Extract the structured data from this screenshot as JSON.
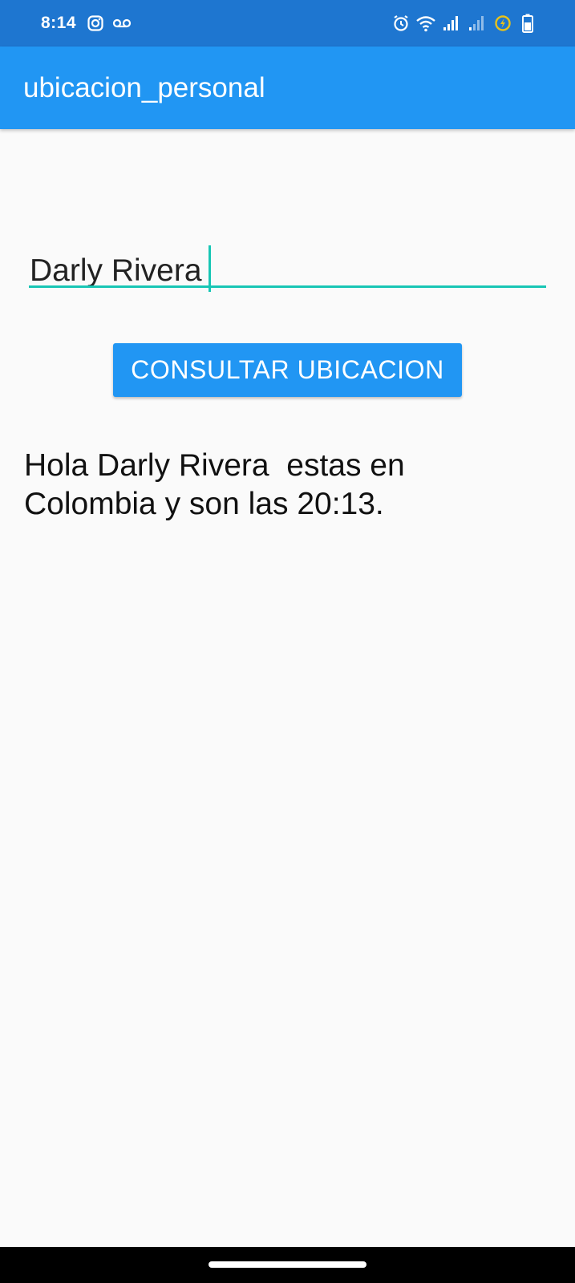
{
  "status_bar": {
    "time": "8:14",
    "background": "#1e76d0",
    "left_icons": [
      "instagram-icon",
      "voicemail-icon"
    ],
    "right_icons": [
      "alarm-icon",
      "wifi-icon",
      "signal-icon",
      "signal-weak-icon",
      "battery-saver-icon",
      "battery-icon"
    ]
  },
  "app_bar": {
    "title": "ubicacion_personal",
    "background": "#2196f3"
  },
  "name_input": {
    "value": "Darly Rivera",
    "accent_color": "#18c6b5"
  },
  "consult_button": {
    "label": "CONSULTAR UBICACION",
    "background": "#2196f3"
  },
  "result": {
    "text": "Hola Darly Rivera  estas en Colombia y son las 20:13."
  }
}
